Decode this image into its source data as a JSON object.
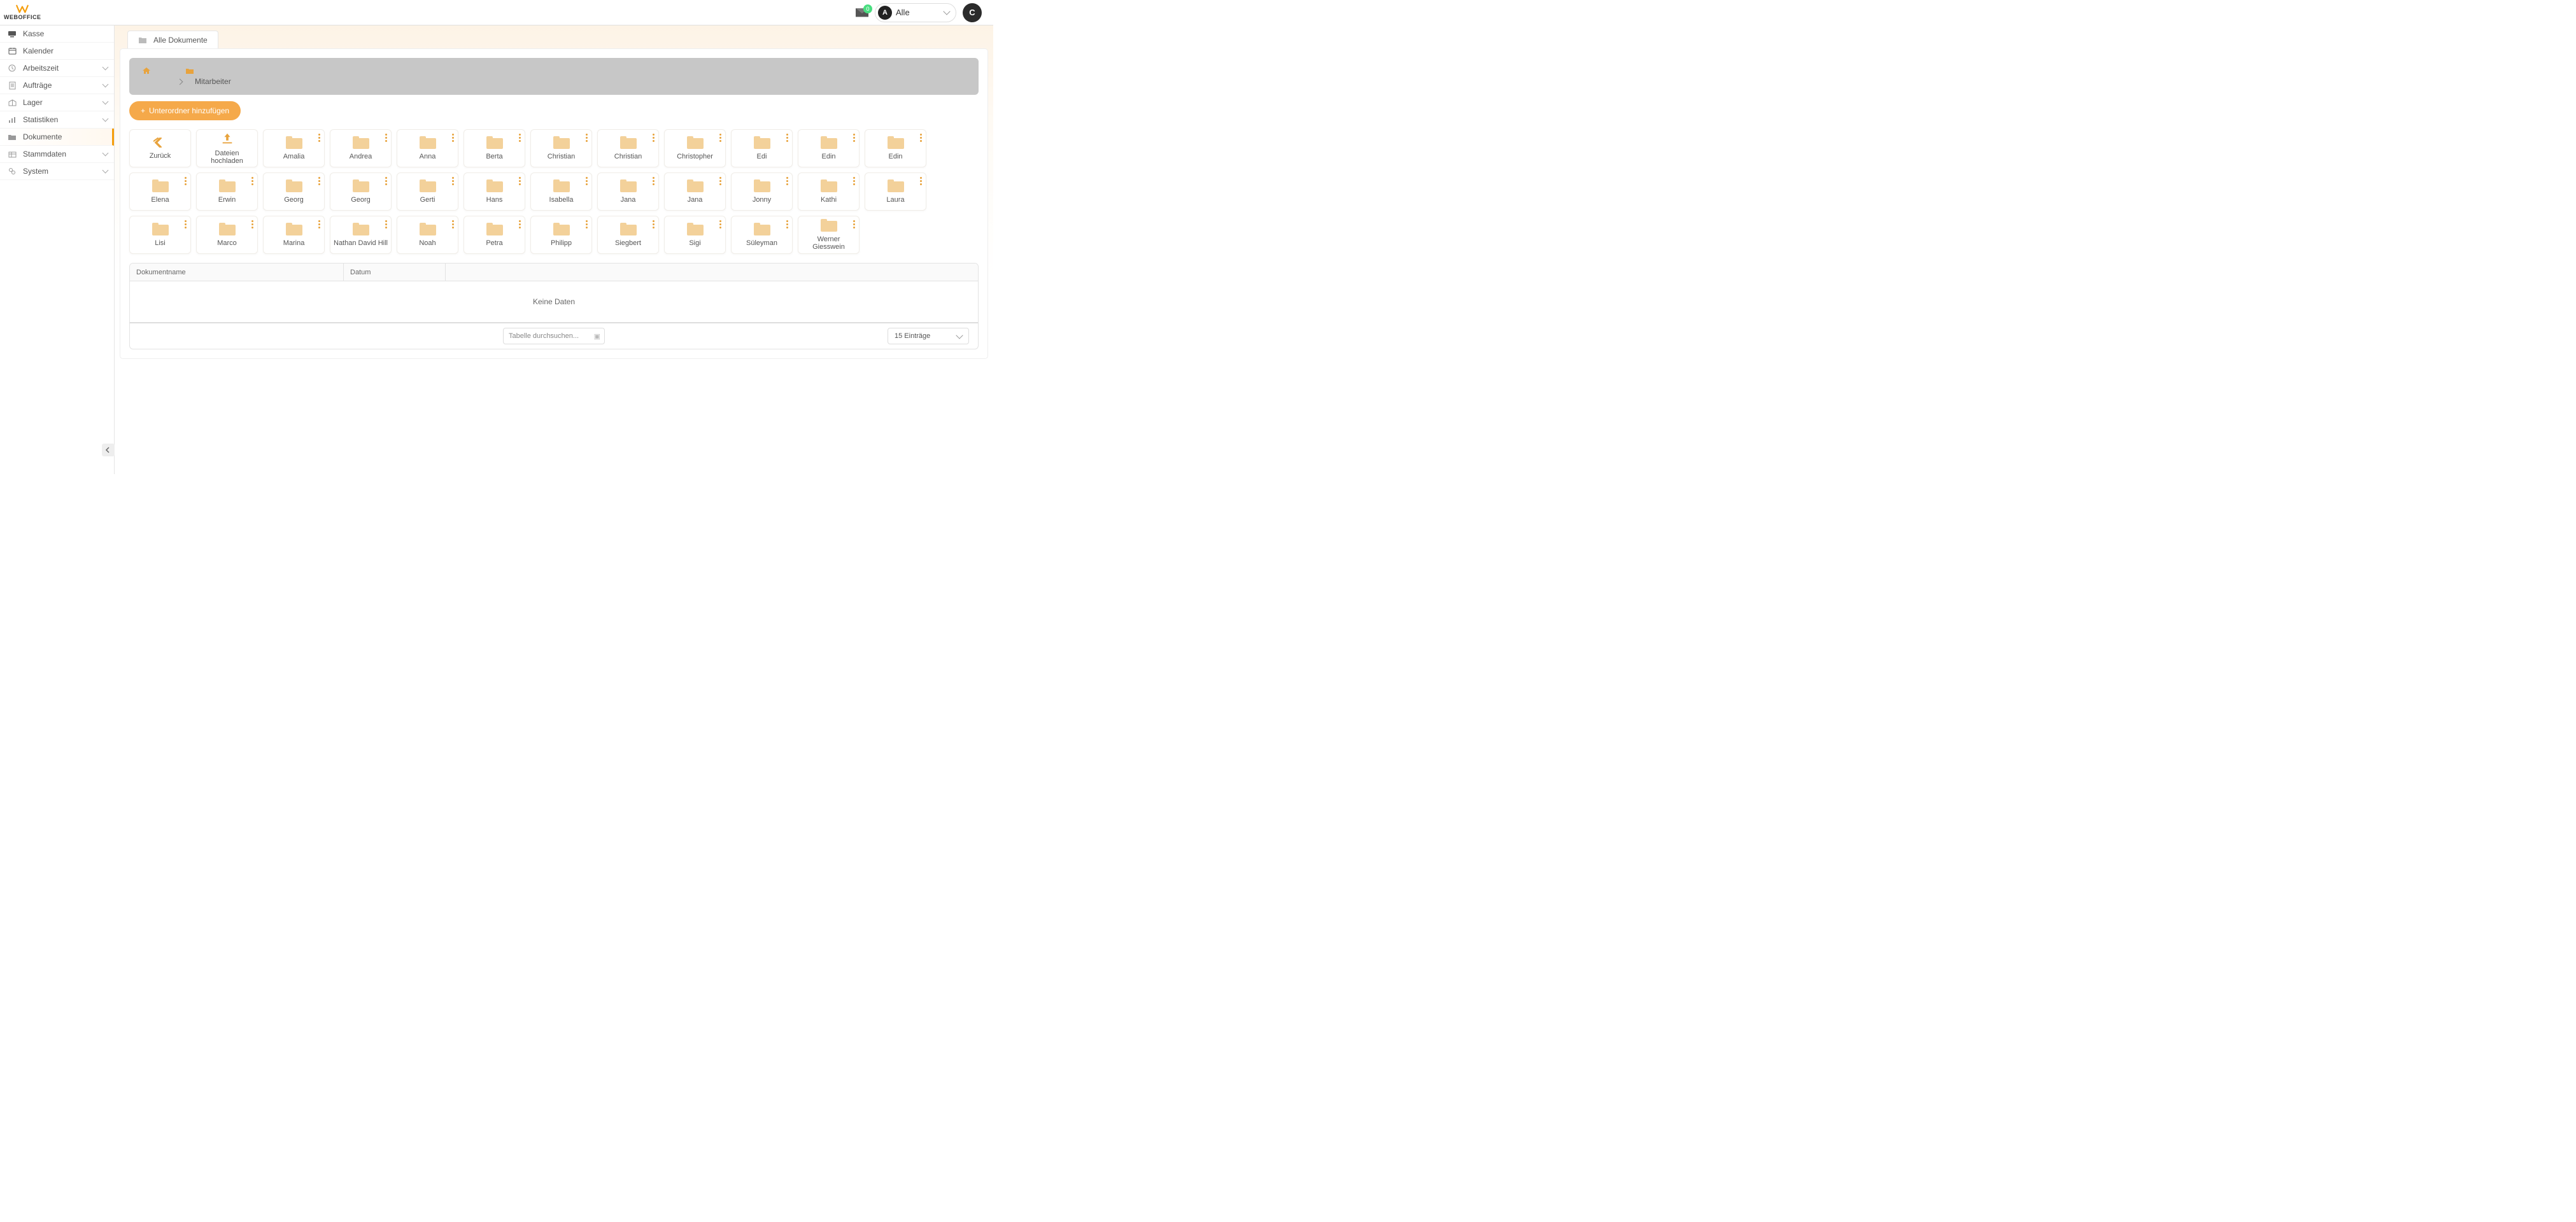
{
  "brand": "WEBOFFICE",
  "header": {
    "mail_count": "0",
    "filter_avatar_letter": "A",
    "filter_label": "Alle",
    "user_avatar_letter": "C"
  },
  "sidebar": {
    "items": [
      {
        "label": "Kasse",
        "icon": "🖥",
        "expandable": false
      },
      {
        "label": "Kalender",
        "icon": "📅",
        "expandable": false
      },
      {
        "label": "Arbeitszeit",
        "icon": "🕒",
        "expandable": true
      },
      {
        "label": "Aufträge",
        "icon": "📄",
        "expandable": true
      },
      {
        "label": "Lager",
        "icon": "📦",
        "expandable": true
      },
      {
        "label": "Statistiken",
        "icon": "📊",
        "expandable": true
      },
      {
        "label": "Dokumente",
        "icon": "📁",
        "expandable": false,
        "active": true
      },
      {
        "label": "Stammdaten",
        "icon": "🗂",
        "expandable": true
      },
      {
        "label": "System",
        "icon": "⚙",
        "expandable": true
      }
    ]
  },
  "tab": {
    "label": "Alle Dokumente"
  },
  "breadcrumb": {
    "current": "Mitarbeiter"
  },
  "actions": {
    "add_subfolder": "Unterordner hinzufügen"
  },
  "tiles": {
    "back": "Zurück",
    "upload": "Dateien hochladen",
    "folders": [
      "Amalia",
      "Andrea",
      "Anna",
      "Berta",
      "Christian",
      "Christian",
      "Christopher",
      "Edi",
      "Edin",
      "Edin",
      "Elena",
      "Erwin",
      "Georg",
      "Georg",
      "Gerti",
      "Hans",
      "Isabella",
      "Jana",
      "Jana",
      "Jonny",
      "Kathi",
      "Laura",
      "Lisi",
      "Marco",
      "Marina",
      "Nathan David Hill",
      "Noah",
      "Petra",
      "Philipp",
      "Siegbert",
      "Sigi",
      "Süleyman",
      "Werner Giesswein"
    ]
  },
  "table": {
    "col_name": "Dokumentname",
    "col_date": "Datum",
    "empty": "Keine Daten",
    "search_placeholder": "Tabelle durchsuchen...",
    "entries_label": "15 Einträge"
  }
}
